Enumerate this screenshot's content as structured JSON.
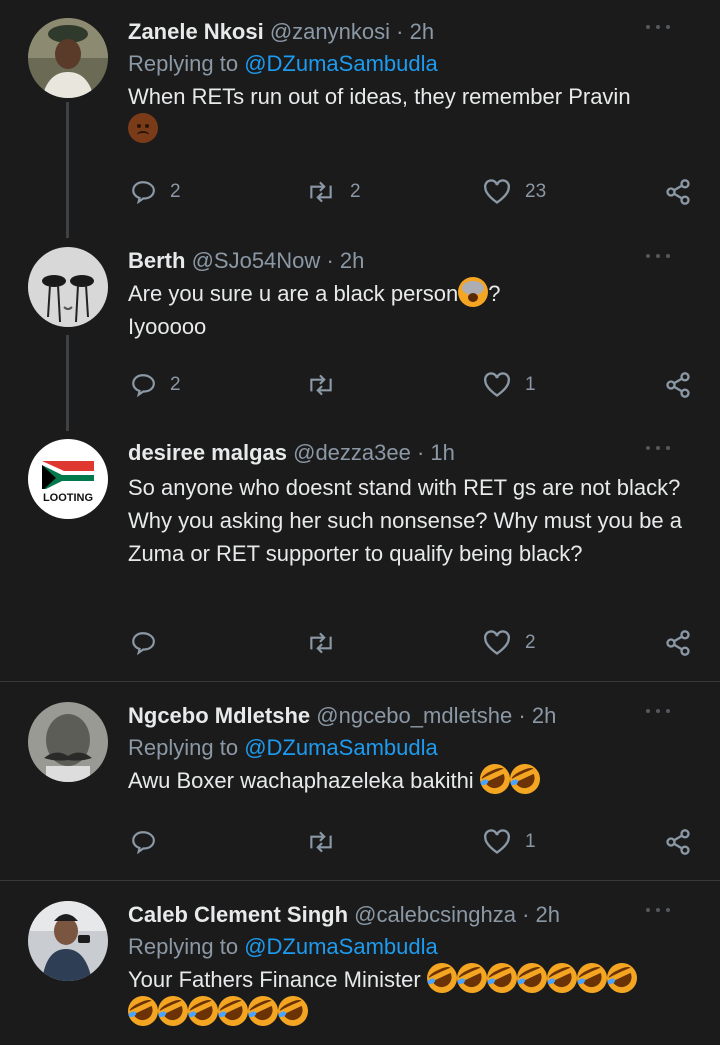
{
  "tweets": [
    {
      "name": "Zanele Nkosi",
      "handle": "@zanynkosi",
      "time": "· 2h",
      "replying_label": "Replying to",
      "replying_to": "@DZumaSambudla",
      "text": "When RETs run out of ideas, they remember Pravin",
      "emoji": [
        "pensive-face"
      ],
      "replies": "2",
      "retweets": "2",
      "likes": "23"
    },
    {
      "name": "Berth",
      "handle": "@SJo54Now",
      "time": "· 2h",
      "text_line1": "Are you sure u are a black person",
      "text_line1_suffix": "?",
      "text_line2": "Iyooooo",
      "emoji": [
        "crying-face"
      ],
      "replies": "2",
      "retweets": "",
      "likes": "1"
    },
    {
      "name": "desiree malgas",
      "handle": "@dezza3ee",
      "time": "· 1h",
      "avatar_text": "LOOTING",
      "text": "So anyone who doesnt stand with RET gs are not black? Why you asking her such nonsense? Why must you be a Zuma or RET supporter to qualify being black?",
      "replies": "",
      "retweets": "",
      "likes": "2"
    },
    {
      "name": "Ngcebo Mdletshe",
      "handle": "@ngcebo_mdletshe",
      "time": "· 2h",
      "replying_label": "Replying to",
      "replying_to": "@DZumaSambudla",
      "text": "Awu Boxer wachaphazeleka bakithi",
      "emoji": [
        "rofl",
        "rofl"
      ],
      "replies": "",
      "retweets": "",
      "likes": "1"
    },
    {
      "name": "Caleb Clement Singh",
      "handle": "@calebcsinghza",
      "time": "· 2h",
      "replying_label": "Replying to",
      "replying_to": "@DZumaSambudla",
      "text": "Your Fathers Finance Minister",
      "emoji": [
        "rofl"
      ]
    }
  ],
  "colors": {
    "background": "#1b1b1b",
    "mention": "#1d9bf0",
    "muted": "#8b98a5"
  },
  "icons": [
    "reply-icon",
    "retweet-icon",
    "like-icon",
    "share-icon",
    "more-icon"
  ]
}
